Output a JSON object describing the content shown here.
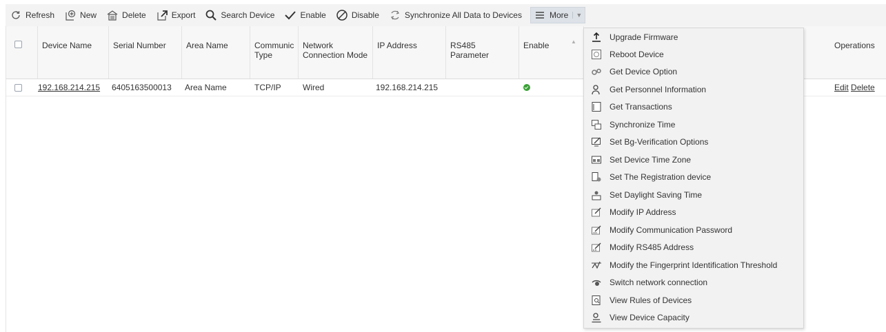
{
  "toolbar": {
    "refresh": "Refresh",
    "new": "New",
    "delete": "Delete",
    "export": "Export",
    "search_device": "Search Device",
    "enable": "Enable",
    "disable": "Disable",
    "sync_all": "Synchronize All Data to Devices",
    "more": "More"
  },
  "table": {
    "headers": {
      "device_name": "Device Name",
      "serial_number": "Serial Number",
      "area_name": "Area Name",
      "comm_type": "Communic Type",
      "network_mode": "Network Connection Mode",
      "ip_address": "IP Address",
      "rs485": "RS485 Parameter",
      "enable": "Enable",
      "operations": "Operations"
    },
    "row": {
      "device_name": "192.168.214.215",
      "serial_number": "6405163500013",
      "area_name": "Area Name",
      "comm_type": "TCP/IP",
      "network_mode": "Wired",
      "ip_address": "192.168.214.215",
      "rs485": "",
      "enable": "enabled",
      "edit": "Edit",
      "delete": "Delete"
    }
  },
  "more_menu": [
    {
      "label": "Upgrade Firmware",
      "icon": "upload-icon"
    },
    {
      "label": "Reboot Device",
      "icon": "reboot-icon"
    },
    {
      "label": "Get Device Option",
      "icon": "gears-icon"
    },
    {
      "label": "Get Personnel Information",
      "icon": "person-icon"
    },
    {
      "label": "Get Transactions",
      "icon": "transactions-icon"
    },
    {
      "label": "Synchronize Time",
      "icon": "sync-time-icon"
    },
    {
      "label": "Set Bg-Verification Options",
      "icon": "edit-monitor-icon"
    },
    {
      "label": "Set Device Time Zone",
      "icon": "time-zone-icon"
    },
    {
      "label": "Set The Registration device",
      "icon": "registration-device-icon"
    },
    {
      "label": "Set Daylight Saving Time",
      "icon": "daylight-time-icon"
    },
    {
      "label": "Modify IP Address",
      "icon": "modify-ip-icon"
    },
    {
      "label": "Modify Communication Password",
      "icon": "modify-password-icon"
    },
    {
      "label": "Modify RS485 Address",
      "icon": "modify-rs485-icon"
    },
    {
      "label": "Modify the Fingerprint Identification Threshold",
      "icon": "fingerprint-threshold-icon"
    },
    {
      "label": "Switch network connection",
      "icon": "network-switch-icon"
    },
    {
      "label": "View Rules of Devices",
      "icon": "view-rules-icon"
    },
    {
      "label": "View Device Capacity",
      "icon": "device-capacity-icon"
    }
  ],
  "colors": {
    "toolbar_bg": "#f3f3f3",
    "menu_bg": "#f2f2f2",
    "enabled_green": "#3aa336"
  }
}
